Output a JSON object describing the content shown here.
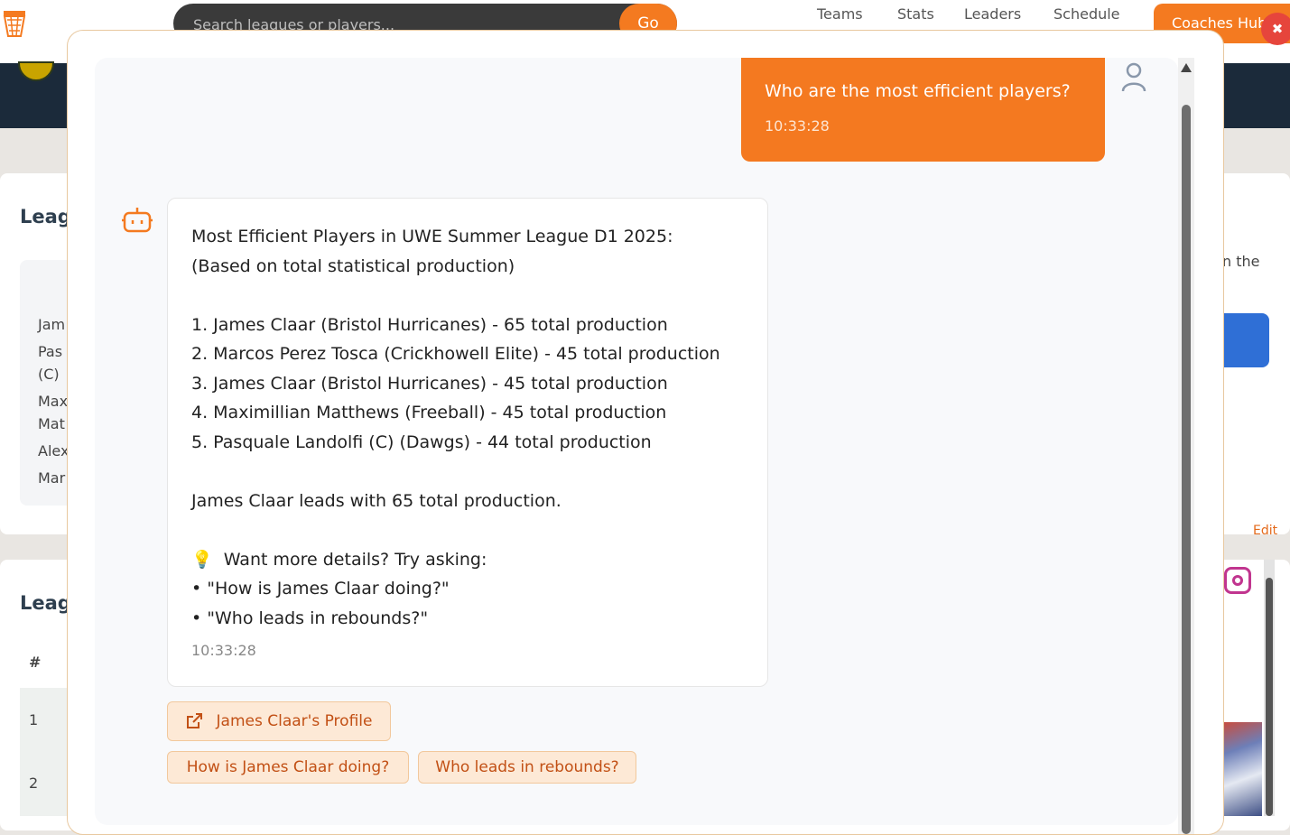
{
  "header": {
    "search_placeholder": "Search leagues or players...",
    "go_label": "Go",
    "nav": [
      "Teams",
      "Stats",
      "Leaders",
      "Schedule"
    ],
    "coaches_label": "Coaches Hub",
    "close_glyph": "✖"
  },
  "background": {
    "heading_1": "Leag",
    "heading_2": "Leag",
    "list_fragments": [
      "Jam",
      "Pas",
      "(C)",
      "Max",
      "Mat",
      "Alex",
      "Mar"
    ],
    "table_header": "#",
    "table_rows": [
      "1",
      "2"
    ],
    "right_text": "n the",
    "edit_label": "Edit"
  },
  "chat": {
    "user_message": {
      "text": "Who are the most efficient players?",
      "time": "10:33:28"
    },
    "bot_message": {
      "lines": [
        "Most Efficient Players in UWE Summer League D1 2025:",
        "(Based on total statistical production)",
        "",
        "1. James Claar (Bristol Hurricanes) - 65 total production",
        "2. Marcos Perez Tosca (Crickhowell Elite) - 45 total production",
        "3. James Claar (Bristol Hurricanes) - 45 total production",
        "4. Maximillian Matthews (Freeball) - 45 total production",
        "5. Pasquale Landolfi (C) (Dawgs) - 44 total production",
        "",
        "James Claar leads with 65 total production.",
        "",
        "💡  Want more details? Try asking:",
        "• \"How is James Claar doing?\"",
        "• \"Who leads in rebounds?\""
      ],
      "time": "10:33:28"
    },
    "profile_link": "James Claar's Profile",
    "suggestions": [
      "How is James Claar doing?",
      "Who leads in rebounds?"
    ]
  },
  "colors": {
    "accent": "#f47920",
    "close_button": "#e6453c",
    "chip_bg": "#fde9d6",
    "chip_text": "#c25015"
  }
}
